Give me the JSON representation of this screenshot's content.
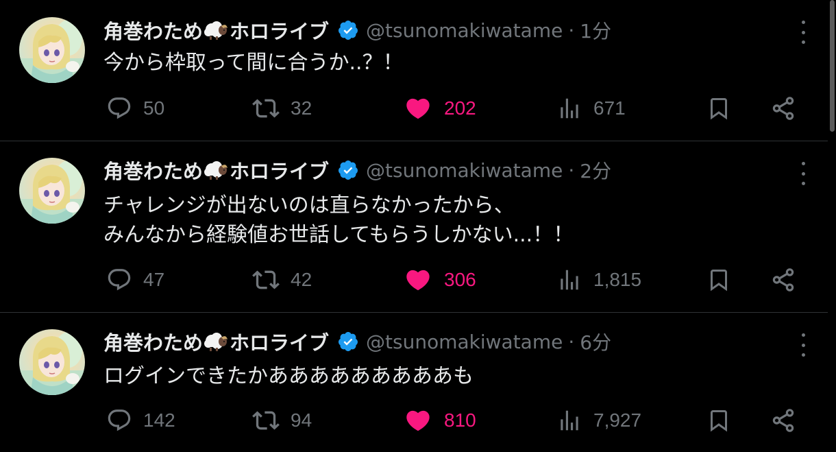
{
  "tweets": [
    {
      "display_name": "角巻わため",
      "display_name_suffix": "ホロライブ",
      "handle": "@tsunomakiwatame",
      "separator": "·",
      "time": "1分",
      "body": [
        "今から枠取って間に合うか..？！"
      ],
      "replies": "50",
      "reposts": "32",
      "likes": "202",
      "views": "671"
    },
    {
      "display_name": "角巻わため",
      "display_name_suffix": "ホロライブ",
      "handle": "@tsunomakiwatame",
      "separator": "·",
      "time": "2分",
      "body": [
        "チャレンジが出ないのは直らなかったから、",
        "みんなから経験値お世話してもらうしかない...！！"
      ],
      "replies": "47",
      "reposts": "42",
      "likes": "306",
      "views": "1,815"
    },
    {
      "display_name": "角巻わため",
      "display_name_suffix": "ホロライブ",
      "handle": "@tsunomakiwatame",
      "separator": "·",
      "time": "6分",
      "body": [
        "ログインできたかあああああああああも"
      ],
      "replies": "142",
      "reposts": "94",
      "likes": "810",
      "views": "7,927"
    }
  ],
  "icons": {
    "name_emoji": "sheep-icon",
    "verified": "verified-badge-icon",
    "more": "more-icon",
    "reply": "reply-icon",
    "repost": "repost-icon",
    "like": "heart-icon",
    "views": "views-icon",
    "bookmark": "bookmark-icon",
    "share": "share-icon"
  },
  "colors": {
    "background": "#000000",
    "text": "#e7e9ea",
    "secondary": "#71767b",
    "like": "#f91880",
    "verified": "#1d9bf0",
    "divider": "#2f3336"
  }
}
